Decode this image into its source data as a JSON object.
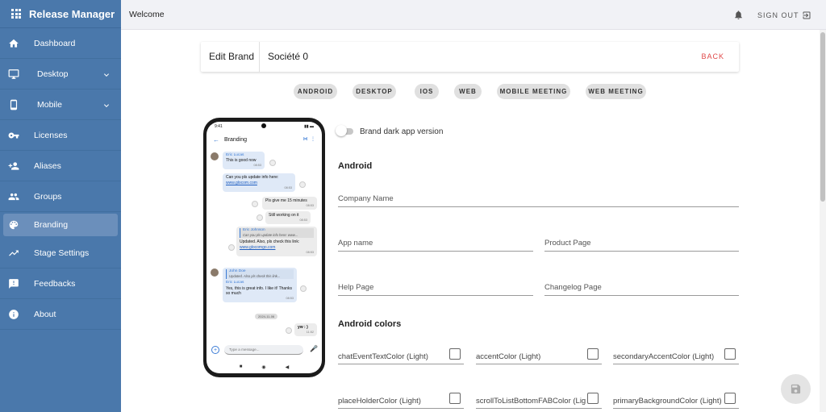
{
  "app": {
    "title": "Release Manager",
    "icon": "apps-grid-icon"
  },
  "sidebar": {
    "items": [
      {
        "label": "Dashboard",
        "icon": "home-icon"
      },
      {
        "label": "Desktop",
        "icon": "monitor-icon",
        "expandable": true
      },
      {
        "label": "Mobile",
        "icon": "phone-icon",
        "expandable": true
      },
      {
        "label": "Licenses",
        "icon": "key-icon"
      },
      {
        "label": "Aliases",
        "icon": "person-add-icon"
      },
      {
        "label": "Groups",
        "icon": "group-icon"
      },
      {
        "label": "Branding",
        "icon": "palette-icon",
        "active": true
      },
      {
        "label": "Stage Settings",
        "icon": "trending-icon"
      },
      {
        "label": "Feedbacks",
        "icon": "feedback-icon"
      },
      {
        "label": "About",
        "icon": "info-icon"
      }
    ]
  },
  "topbar": {
    "welcome": "Welcome",
    "signout": "SIGN OUT"
  },
  "header": {
    "title": "Edit Brand",
    "brand_name": "Société 0",
    "back": "BACK"
  },
  "platform_tabs": [
    "ANDROID",
    "DESKTOP",
    "IOS",
    "WEB",
    "MOBILE MEETING",
    "WEB MEETING"
  ],
  "phone_preview": {
    "time": "9:41",
    "screen_title": "Branding",
    "messages": [
      {
        "who": "Eric Lucas",
        "text": "This is good now",
        "time": "08:53"
      },
      {
        "text": "Can you pls update info here:",
        "link": "www.glocom.com",
        "time": "08:53"
      },
      {
        "text": "Pls give me 15 minutes",
        "time": "08:53"
      },
      {
        "text": "Still working on it",
        "time": "08:53"
      },
      {
        "quote_who": "Eric Johnson",
        "quote_text": "Can you pls update info here: www...",
        "text": "Updated. Also, pls check this link:",
        "link": "www.glocomgo.com",
        "time": "08:53"
      },
      {
        "quote_who": "John Doe",
        "quote_text": "Updated. Also pls check this link...",
        "who": "Eric Lucas",
        "text": "Yes, this is great info. I like it! Thanks so much",
        "time": "08:53"
      },
      {
        "date": "2024-11-06"
      },
      {
        "text": "yw : )",
        "time": "11:52"
      }
    ],
    "composer_placeholder": "Type a message..."
  },
  "form": {
    "dark_toggle_label": "Brand dark app version",
    "android_section": "Android",
    "fields": {
      "company_name": "Company Name",
      "app_name": "App name",
      "product_page": "Product Page",
      "help_page": "Help Page",
      "changelog_page": "Changelog Page"
    },
    "colors_section": "Android colors",
    "colors": [
      "chatEventTextColor (Light)",
      "accentColor (Light)",
      "secondaryAccentColor (Light)",
      "placeHolderColor (Light)",
      "scrollToListBottomFABColor (Light)",
      "primaryBackgroundColor (Light)"
    ]
  },
  "fab": {
    "icon": "save-icon"
  }
}
